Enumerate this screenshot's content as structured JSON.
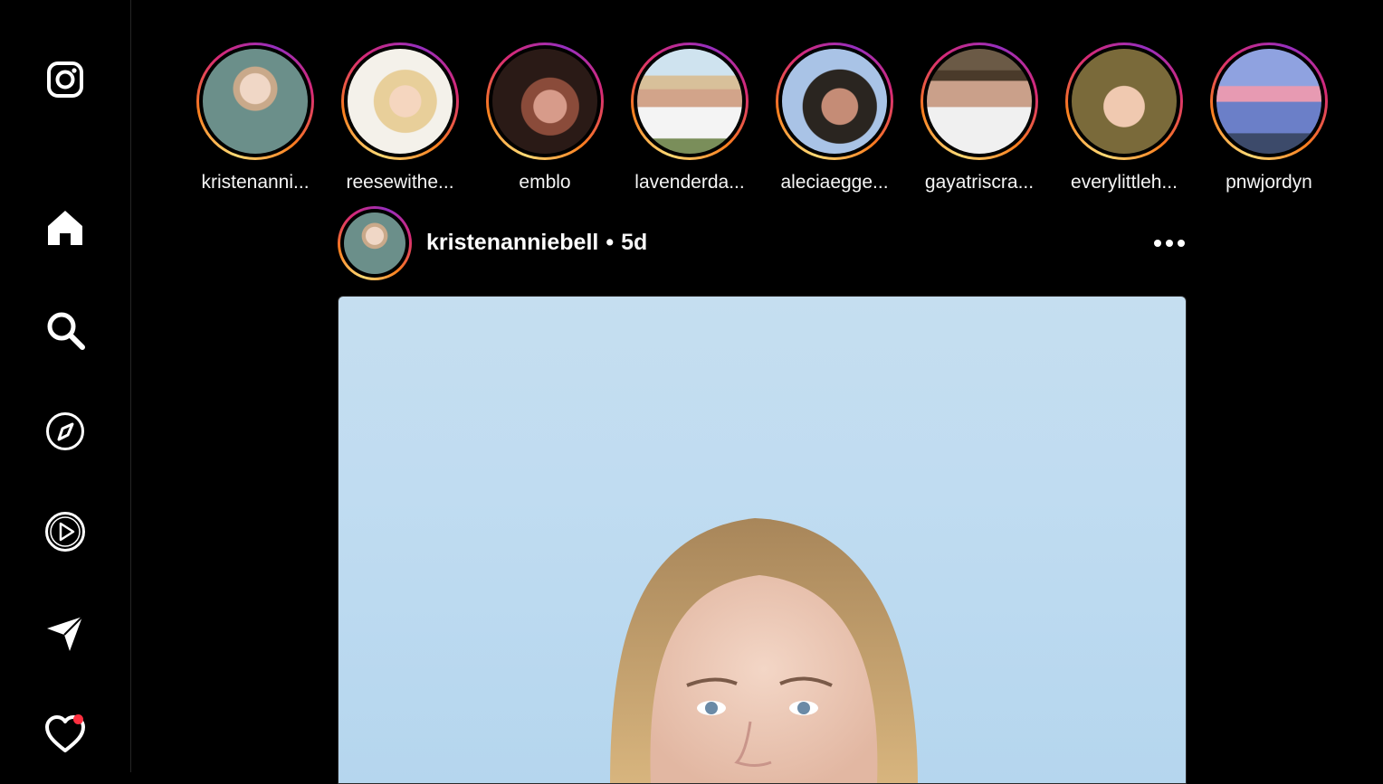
{
  "app": {
    "logo_icon": "instagram-logo-icon",
    "nav": [
      {
        "name": "home",
        "icon": "home-icon"
      },
      {
        "name": "search",
        "icon": "search-icon"
      },
      {
        "name": "explore",
        "icon": "compass-icon"
      },
      {
        "name": "reels",
        "icon": "reels-play-icon"
      },
      {
        "name": "messages",
        "icon": "send-icon"
      },
      {
        "name": "notifications",
        "icon": "heart-icon",
        "has_badge": true
      }
    ],
    "badge_color": "#ff3040"
  },
  "stories": [
    {
      "username": "kristenanni..."
    },
    {
      "username": "reesewithe..."
    },
    {
      "username": "emblo"
    },
    {
      "username": "lavenderda..."
    },
    {
      "username": "aleciaegge..."
    },
    {
      "username": "gayatriscra..."
    },
    {
      "username": "everylittleh..."
    },
    {
      "username": "pnwjordyn"
    }
  ],
  "post": {
    "username": "kristenanniebell",
    "separator": "•",
    "time": "5d",
    "more_icon": "more-dots-icon"
  }
}
